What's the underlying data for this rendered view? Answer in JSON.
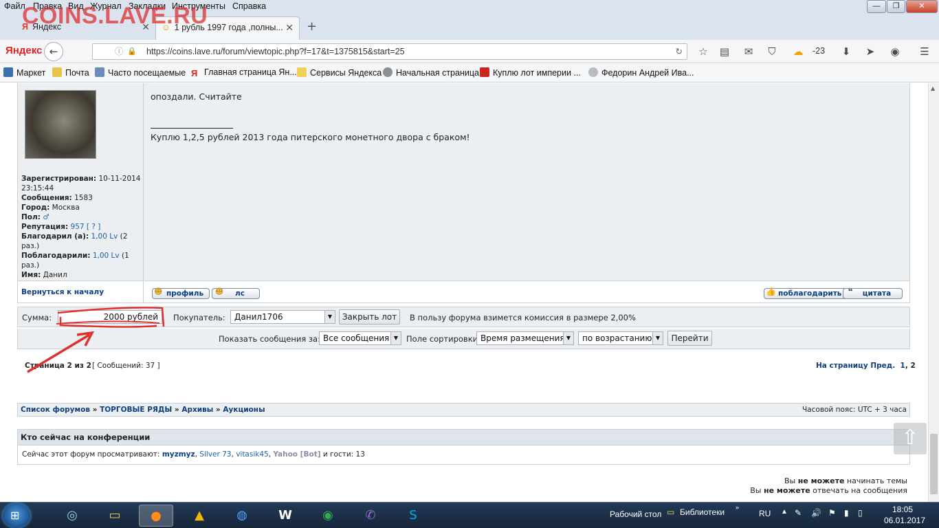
{
  "window": {
    "watermark": "COINS.LAVE.RU",
    "menu": [
      "Файл",
      "Правка",
      "Вид",
      "Журнал",
      "Закладки",
      "Инструменты",
      "Справка"
    ],
    "controls": {
      "minimize": "—",
      "maximize": "❐",
      "close": "✕"
    }
  },
  "tabs": [
    {
      "label": "Яндекс",
      "active": false
    },
    {
      "label": "1 рубль 1997 года ,полны...",
      "active": true
    }
  ],
  "nav": {
    "brand": "Яндекс",
    "url": "https://coins.lave.ru/forum/viewtopic.php?f=17&t=1375815&start=25",
    "weather": "-23"
  },
  "bookmarks": [
    "Маркет",
    "Почта",
    "Часто посещаемые",
    "Главная страница Ян...",
    "Сервисы Яндекса",
    "Начальная страница",
    "Куплю лот империи ...",
    "Федорин Андрей Ива..."
  ],
  "post": {
    "body": "опоздали. Считайте",
    "signature": "Куплю 1,2,5 рублей 2013 года питерского монетного двора с браком!",
    "poster": {
      "registered_label": "Зарегистрирован:",
      "registered_value": "10-11-2014 23:15:44",
      "messages_label": "Сообщения:",
      "messages_value": "1583",
      "city_label": "Город:",
      "city_value": "Москва",
      "gender_label": "Пол:",
      "gender_value": "♂",
      "reputation_label": "Репутация:",
      "reputation_value": "957",
      "reputation_link": "[ ? ]",
      "thanked_label": "Благодарил (а):",
      "thanked_value": "1,00 Lv",
      "thanked_times": "(2 раз.)",
      "been_thanked_label": "Поблагодарили:",
      "been_thanked_value": "1,00 Lv",
      "been_thanked_times": "(1 раз.)",
      "name_label": "Имя:",
      "name_value": "Данил"
    },
    "back_to_top": "Вернуться к началу",
    "buttons": {
      "profile": "профиль",
      "pm": "лс",
      "thank": "поблагодарить",
      "quote": "цитата"
    }
  },
  "lot": {
    "sum_label": "Сумма:",
    "sum_value": "2000 рублей",
    "buyer_label": "Покупатель:",
    "buyer_value": "Данил1706",
    "close_button": "Закрыть лот",
    "commission_note": "В пользу форума взимется комиссия в размере 2,00%"
  },
  "sort": {
    "show_label": "Показать сообщения за:",
    "show_value": "Все сообщения",
    "sort_label": "Поле сортировки",
    "sort_value": "Время размещения",
    "order_value": "по возрастанию",
    "go_button": "Перейти"
  },
  "pagination": {
    "page_info": "Страница 2 из 2",
    "messages_info": "[ Сообщений: 37 ]",
    "to_page": "На страницу Пред.",
    "page1": "1",
    "separator": ",",
    "page2": "2"
  },
  "breadcrumb": {
    "items": [
      "Список форумов",
      "ТОРГОВЫЕ РЯДЫ",
      "Архивы",
      "Аукционы"
    ],
    "sep": "»",
    "timezone": "Часовой пояс: UTC + 3 часа"
  },
  "online": {
    "title": "Кто сейчас на конференции",
    "prefix": "Сейчас этот форум просматривают:",
    "users": [
      "myzmyz",
      "Silver 73",
      "vitasik45",
      "Yahoo [Bot]"
    ],
    "suffix": "и гости: 13"
  },
  "permissions": [
    {
      "pre": "Вы",
      "bold": "не можете",
      "post": "начинать темы"
    },
    {
      "pre": "Вы",
      "bold": "не можете",
      "post": "отвечать на сообщения"
    }
  ],
  "taskbar": {
    "desktop_label": "Рабочий стол",
    "libraries_label": "Библиотеки",
    "lang": "RU",
    "time": "18:05",
    "date": "06.01.2017"
  },
  "colors": {
    "accent_red": "#e0302c",
    "link": "#1b5fa8",
    "bold_link": "#0d3f80"
  }
}
